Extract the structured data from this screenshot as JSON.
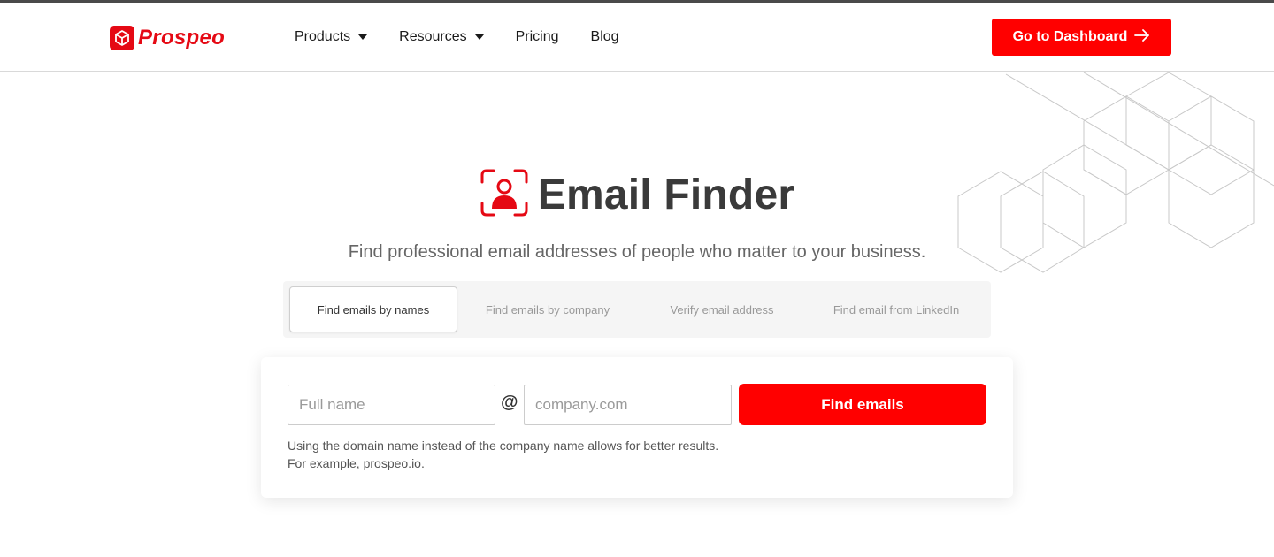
{
  "brand": {
    "name": "Prospeo",
    "color": "#e50914"
  },
  "nav": {
    "items": [
      {
        "label": "Products",
        "dropdown": true
      },
      {
        "label": "Resources",
        "dropdown": true
      },
      {
        "label": "Pricing",
        "dropdown": false
      },
      {
        "label": "Blog",
        "dropdown": false
      }
    ],
    "cta_label": "Go to Dashboard",
    "cta_icon": "arrow-right-icon"
  },
  "hero": {
    "icon": "person-focus-icon",
    "title": "Email Finder",
    "subtitle": "Find professional email addresses of people who matter to your business."
  },
  "tabs": [
    {
      "label": "Find emails by names",
      "active": true
    },
    {
      "label": "Find emails by company",
      "active": false
    },
    {
      "label": "Verify email address",
      "active": false
    },
    {
      "label": "Find email from LinkedIn",
      "active": false
    }
  ],
  "form": {
    "name_placeholder": "Full name",
    "at_symbol": "@",
    "company_placeholder": "company.com",
    "submit_label": "Find emails",
    "hint_line1": "Using the domain name instead of the company name allows for better results.",
    "hint_line2": "For example, prospeo.io."
  },
  "colors": {
    "accent": "#ff0000",
    "text_dark": "#3a3a3a",
    "text_muted": "#666666"
  }
}
